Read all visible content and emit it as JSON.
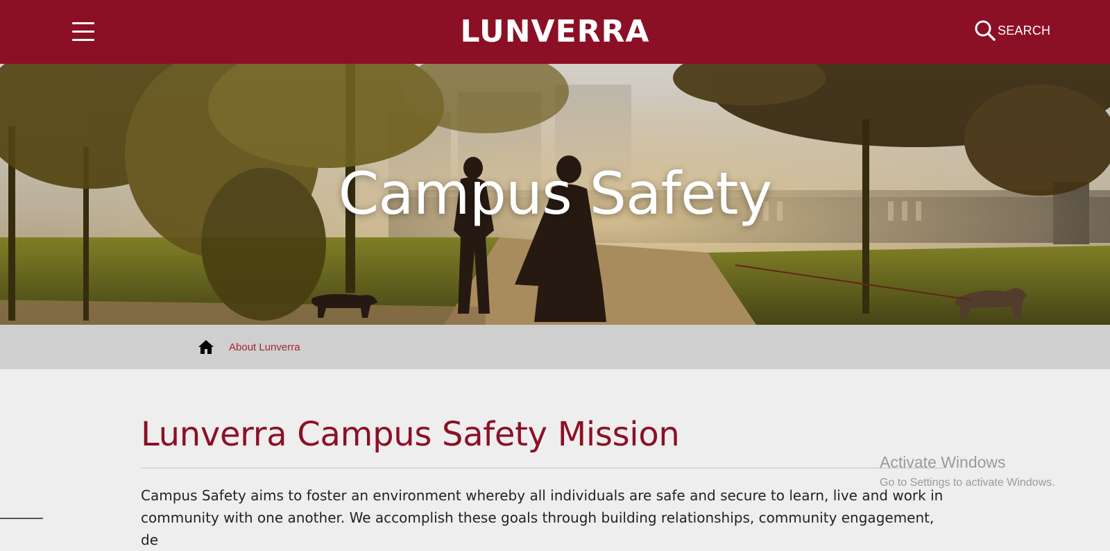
{
  "header": {
    "brand": "LUNVERRA",
    "search_label": "SEARCH",
    "menu_icon": "hamburger-menu-icon",
    "search_icon": "magnifier-icon",
    "background_color": "#8b1026"
  },
  "hero": {
    "title": "Campus Safety"
  },
  "breadcrumb": {
    "home_icon": "home-icon",
    "items": [
      {
        "label": "About Lunverra"
      }
    ],
    "link_color": "#a3262d"
  },
  "main": {
    "heading": "Lunverra Campus Safety Mission",
    "heading_color": "#8b1026",
    "paragraph": "Campus Safety aims to foster an environment whereby all individuals are safe and secure to learn, live and work in community with one another. We accomplish these goals through building relationships, community engagement, de"
  },
  "watermark": {
    "title": "Activate Windows",
    "subtitle": "Go to Settings to activate Windows."
  }
}
